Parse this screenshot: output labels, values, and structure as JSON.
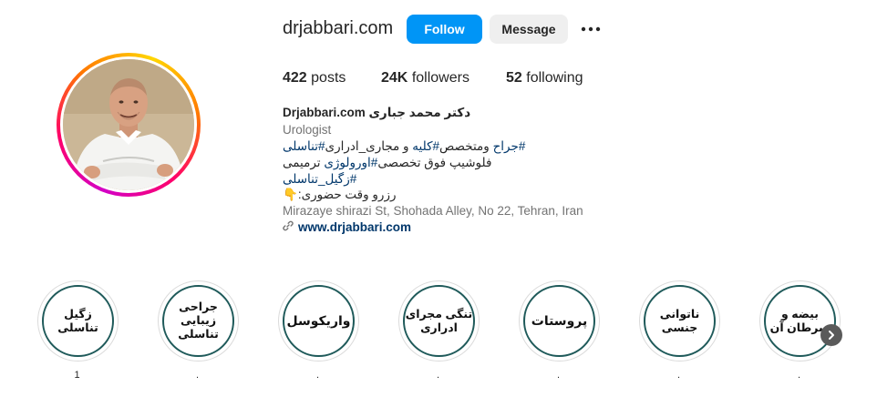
{
  "profile": {
    "username": "drjabbari.com",
    "follow_label": "Follow",
    "message_label": "Message",
    "more_icon": "more-dots-icon",
    "stats": {
      "posts_count": "422",
      "posts_label": "posts",
      "followers_count": "24K",
      "followers_label": "followers",
      "following_count": "52",
      "following_label": "following"
    },
    "bio": {
      "name_latin": "Drjabbari.com",
      "name_fa": "دکتر محمد جباری",
      "category": "Urologist",
      "line1_tag1": "#جراح",
      "line1_word": " ومتخصص",
      "line1_tag2": "#کلیه",
      "line1_word2": " و مجاری_ادراری",
      "line1_tag3": "#تناسلی",
      "line2_text": "فلوشیپ فوق تخصصی",
      "line2_tag": "#اورولوژی",
      "line2_text2": " ترمیمی",
      "line3_tag": "#زگیل_تناسلی",
      "line4_text": "رزرو وقت حضوری:",
      "line4_emoji": "👇",
      "address": "Mirazaye shirazi St, Shohada Alley, No 22, Tehran, Iran",
      "website": "www.drjabbari.com"
    }
  },
  "highlights": [
    {
      "label": "زگیل تناسلی",
      "caption": "1"
    },
    {
      "label": "جراحی زیبایی تناسلی",
      "caption": "."
    },
    {
      "label": "واریکوسل",
      "caption": "."
    },
    {
      "label": "تنگی مجرای ادراری",
      "caption": "."
    },
    {
      "label": "پروستات",
      "caption": "."
    },
    {
      "label": "ناتوانی جنسی",
      "caption": "."
    },
    {
      "label": "بیضه و سرطان آن",
      "caption": "."
    }
  ],
  "colors": {
    "follow_bg": "#0095f6",
    "message_bg": "#efefef",
    "link": "#00376b",
    "muted": "#737373",
    "highlight_ring": "#1f5a5a"
  }
}
